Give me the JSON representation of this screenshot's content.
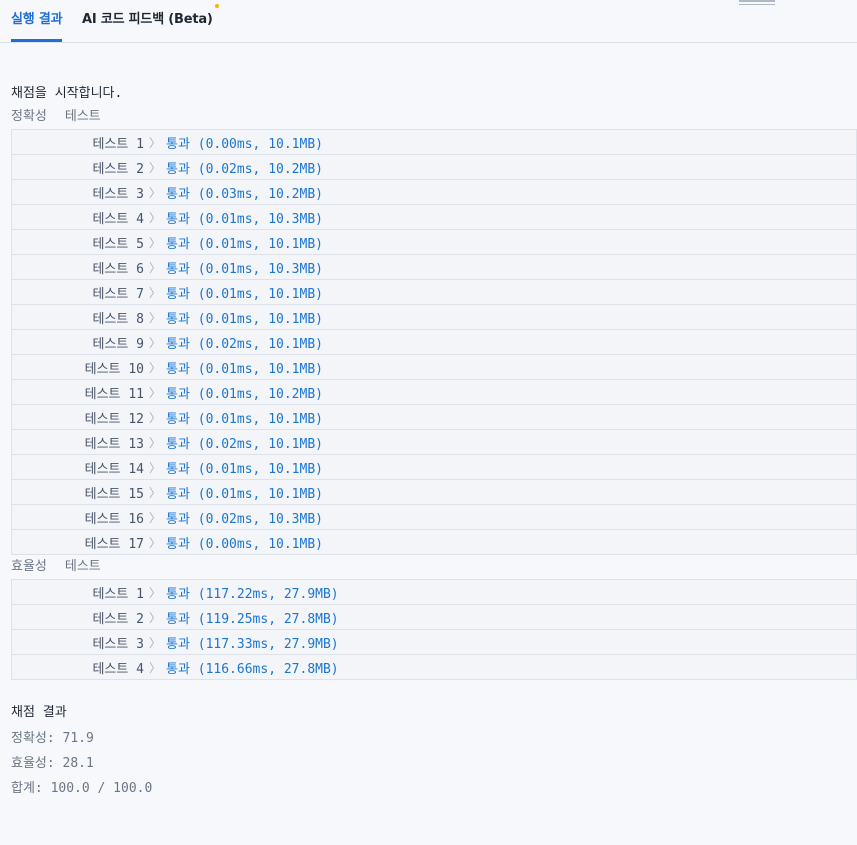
{
  "tabs": {
    "run_result": "실행 결과",
    "ai_feedback": "AI 코드 피드백 (Beta)"
  },
  "console": {
    "start_message": "채점을 시작합니다.",
    "accuracy_section": {
      "label": "정확성",
      "sub": "테스트"
    },
    "efficiency_section": {
      "label": "효율성",
      "sub": "테스트"
    },
    "arrow_glyph": "〉",
    "accuracy_tests": [
      {
        "name": "테스트 1",
        "status": "통과",
        "detail": "(0.00ms, 10.1MB)"
      },
      {
        "name": "테스트 2",
        "status": "통과",
        "detail": "(0.02ms, 10.2MB)"
      },
      {
        "name": "테스트 3",
        "status": "통과",
        "detail": "(0.03ms, 10.2MB)"
      },
      {
        "name": "테스트 4",
        "status": "통과",
        "detail": "(0.01ms, 10.3MB)"
      },
      {
        "name": "테스트 5",
        "status": "통과",
        "detail": "(0.01ms, 10.1MB)"
      },
      {
        "name": "테스트 6",
        "status": "통과",
        "detail": "(0.01ms, 10.3MB)"
      },
      {
        "name": "테스트 7",
        "status": "통과",
        "detail": "(0.01ms, 10.1MB)"
      },
      {
        "name": "테스트 8",
        "status": "통과",
        "detail": "(0.01ms, 10.1MB)"
      },
      {
        "name": "테스트 9",
        "status": "통과",
        "detail": "(0.02ms, 10.1MB)"
      },
      {
        "name": "테스트 10",
        "status": "통과",
        "detail": "(0.01ms, 10.1MB)"
      },
      {
        "name": "테스트 11",
        "status": "통과",
        "detail": "(0.01ms, 10.2MB)"
      },
      {
        "name": "테스트 12",
        "status": "통과",
        "detail": "(0.01ms, 10.1MB)"
      },
      {
        "name": "테스트 13",
        "status": "통과",
        "detail": "(0.02ms, 10.1MB)"
      },
      {
        "name": "테스트 14",
        "status": "통과",
        "detail": "(0.01ms, 10.1MB)"
      },
      {
        "name": "테스트 15",
        "status": "통과",
        "detail": "(0.01ms, 10.1MB)"
      },
      {
        "name": "테스트 16",
        "status": "통과",
        "detail": "(0.02ms, 10.3MB)"
      },
      {
        "name": "테스트 17",
        "status": "통과",
        "detail": "(0.00ms, 10.1MB)"
      }
    ],
    "efficiency_tests": [
      {
        "name": "테스트 1",
        "status": "통과",
        "detail": "(117.22ms, 27.9MB)"
      },
      {
        "name": "테스트 2",
        "status": "통과",
        "detail": "(119.25ms, 27.8MB)"
      },
      {
        "name": "테스트 3",
        "status": "통과",
        "detail": "(117.33ms, 27.9MB)"
      },
      {
        "name": "테스트 4",
        "status": "통과",
        "detail": "(116.66ms, 27.8MB)"
      }
    ],
    "summary": {
      "title": "채점 결과",
      "accuracy": "정확성: 71.9",
      "efficiency": "효율성: 28.1",
      "total": "합계: 100.0 / 100.0"
    }
  },
  "colors": {
    "accent": "#1e6fd9",
    "pass": "#1b76d2",
    "beta_dot": "#ffb300"
  }
}
